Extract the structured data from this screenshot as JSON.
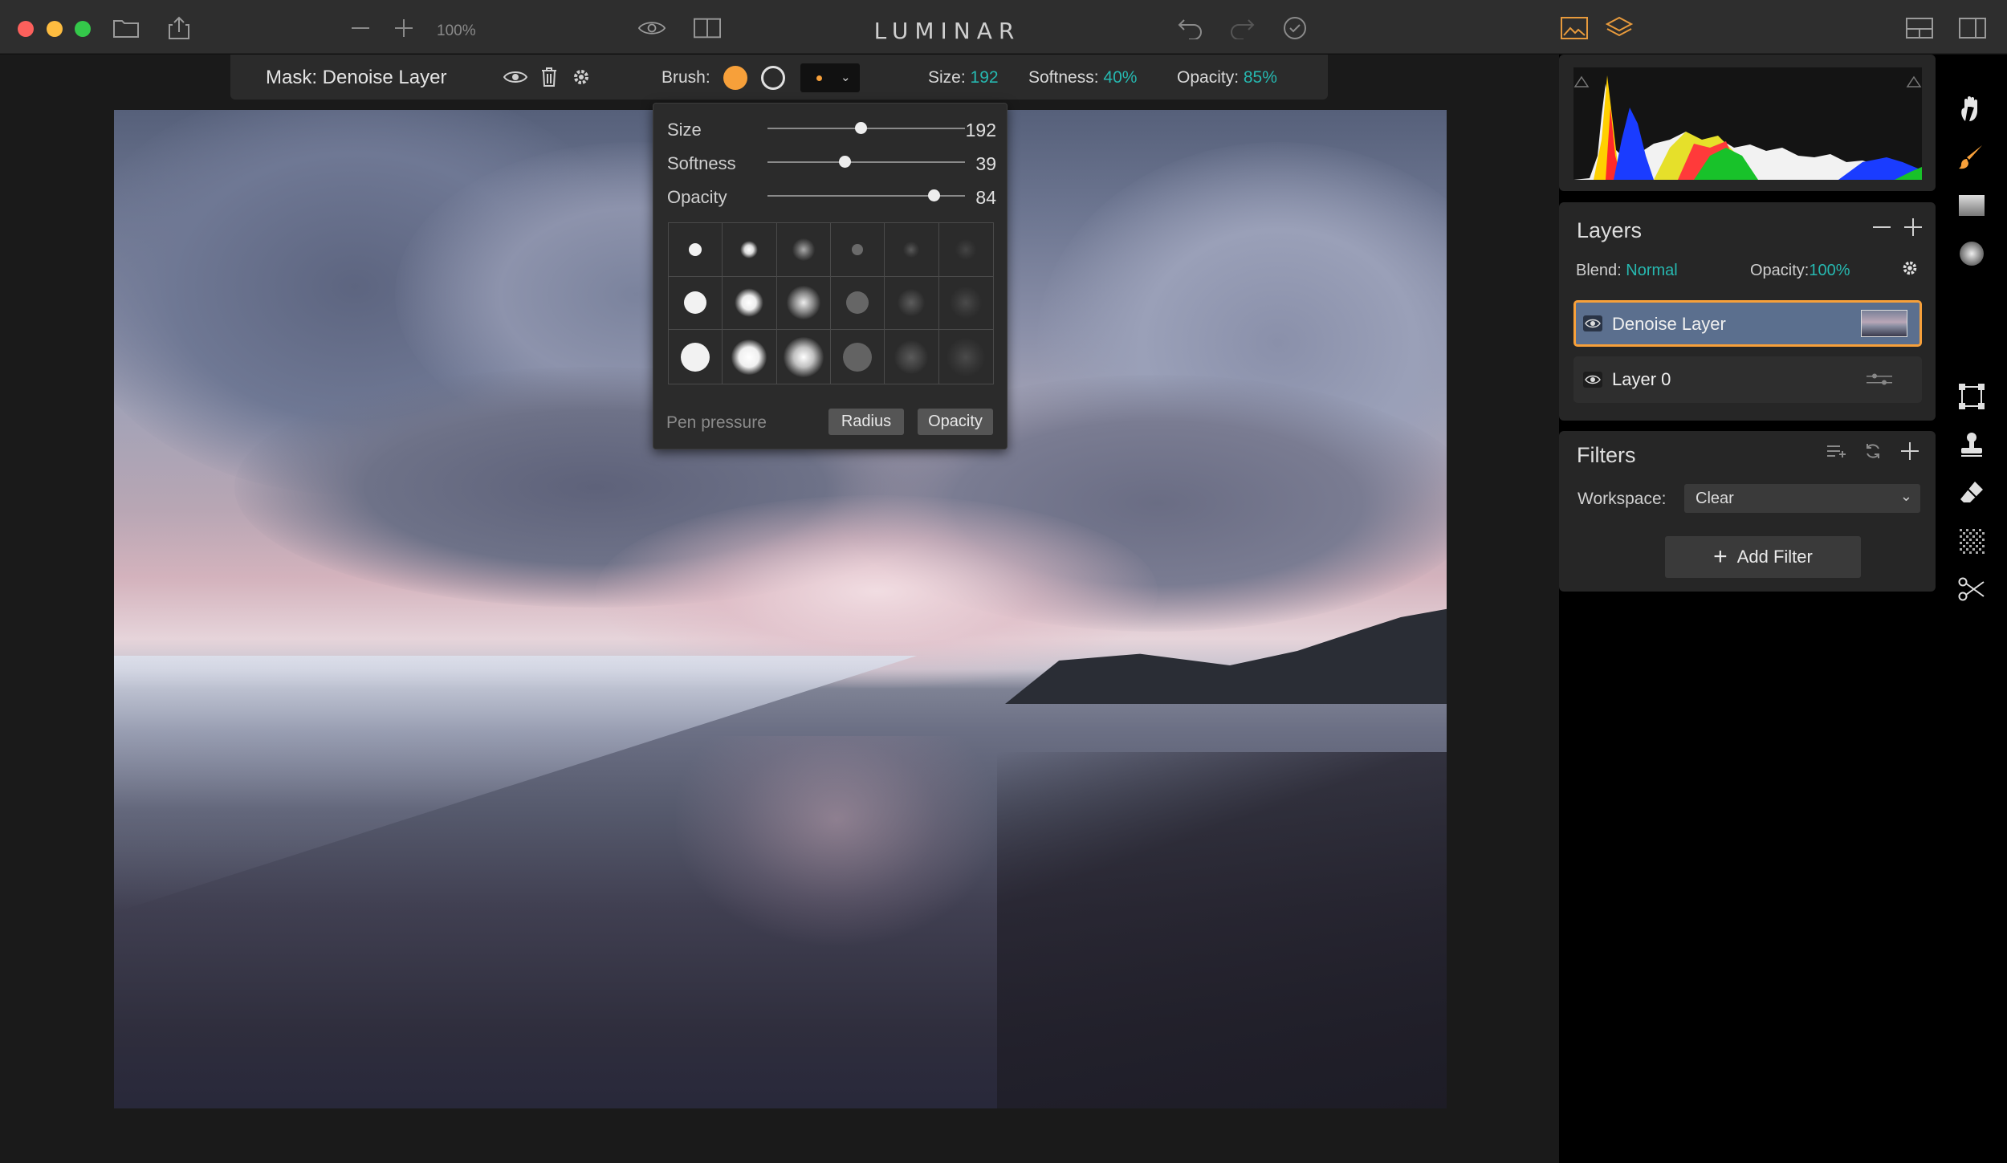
{
  "app": {
    "title": "LUMINAR",
    "zoom": "100%"
  },
  "mask_toolbar": {
    "title": "Mask: Denoise Layer",
    "brush_label": "Brush:",
    "size_label": "Size:",
    "size_value": "192",
    "softness_label": "Softness:",
    "softness_value": "40%",
    "opacity_label": "Opacity:",
    "opacity_value": "85%"
  },
  "brush_popover": {
    "sliders": [
      {
        "label": "Size",
        "value": "192",
        "fraction": 0.47
      },
      {
        "label": "Softness",
        "value": "39",
        "fraction": 0.39
      },
      {
        "label": "Opacity",
        "value": "84",
        "fraction": 0.84
      }
    ],
    "pen_pressure_label": "Pen pressure",
    "radius_button": "Radius",
    "opacity_button": "Opacity"
  },
  "layers": {
    "title": "Layers",
    "blend_label": "Blend:",
    "blend_value": "Normal",
    "opacity_label": "Opacity:",
    "opacity_value": "100%",
    "items": [
      {
        "name": "Denoise Layer",
        "selected": true
      },
      {
        "name": "Layer 0",
        "selected": false
      }
    ]
  },
  "filters": {
    "title": "Filters",
    "workspace_label": "Workspace:",
    "workspace_value": "Clear",
    "add_filter_label": "Add Filter"
  },
  "colors": {
    "accent": "#f7a03a",
    "teal": "#26b8b0",
    "selected_layer": "#5b6f8e"
  }
}
